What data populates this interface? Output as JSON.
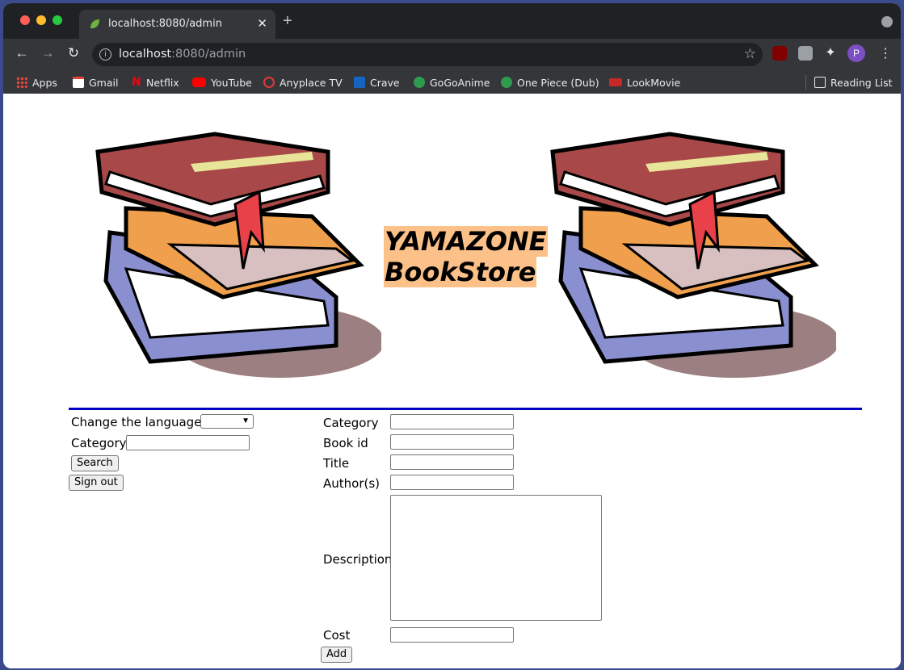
{
  "browser": {
    "tab_title": "localhost:8080/admin",
    "new_tab": "+",
    "close": "✕",
    "url_host": "localhost",
    "url_rest": ":8080/admin",
    "profile_initial": "P",
    "bookmarks": [
      "Apps",
      "Gmail",
      "Netflix",
      "YouTube",
      "Anyplace TV",
      "Crave",
      "GoGoAnime",
      "One Piece (Dub)",
      "LookMovie"
    ],
    "reading_list": "Reading List"
  },
  "header": {
    "brand_line1": "YAMAZONE",
    "brand_line2": "BookStore"
  },
  "sidebar": {
    "language_label": "Change the language:",
    "category_label": "Category",
    "category_value": "",
    "search_button": "Search",
    "signout_button": "Sign out"
  },
  "form": {
    "category_label": "Category",
    "bookid_label": "Book id",
    "title_label": "Title",
    "authors_label": "Author(s)",
    "description_label": "Description",
    "cost_label": "Cost",
    "add_button": "Add"
  },
  "colors": {
    "brand_highlight": "#fcc089",
    "divider": "#0000c4"
  }
}
